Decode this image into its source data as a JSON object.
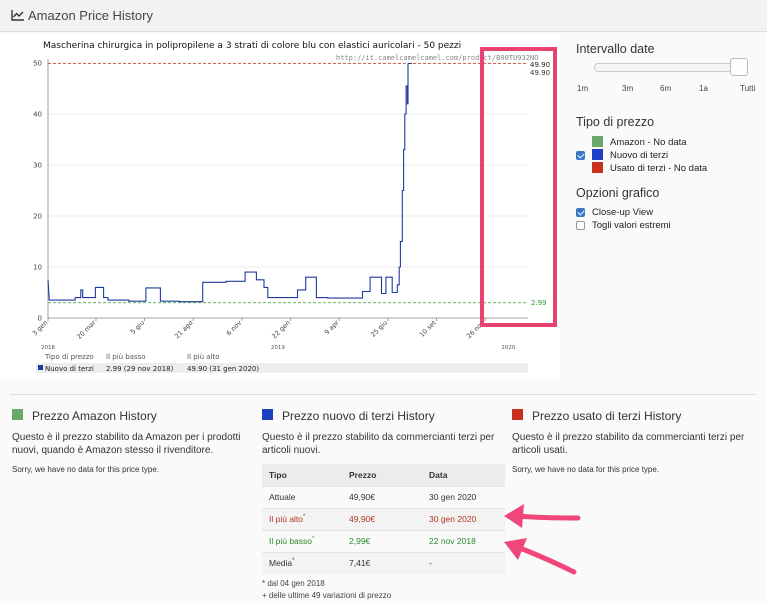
{
  "header": {
    "title": "Amazon Price History"
  },
  "chart": {
    "title": "Mascherina chirurgica in polipropilene a 3 strati di colore blu con elastici auricolari - 50 pezzi",
    "url": "http://it.camelcamelcamel.com/product/B00TU932NO",
    "max_label": "49.90",
    "min_label": "2.99",
    "summary": {
      "col_type": "Tipo di prezzo",
      "col_low": "Il più basso",
      "col_high": "Il più alto",
      "series": "Nuovo di terzi",
      "low": "2.99 (29 nov 2018)",
      "high": "49.90 (31 gen 2020)"
    }
  },
  "chart_data": {
    "type": "line",
    "title": "Mascherina chirurgica in polipropilene a 3 strati di colore blu con elastici auricolari - 50 pezzi",
    "ylim": [
      0,
      50
    ],
    "y_ticks": [
      0,
      10,
      20,
      30,
      40,
      50
    ],
    "x_ticks": [
      "3 gen",
      "20 mar",
      "5 giu",
      "21 ago",
      "6 nov",
      "22 gen",
      "9 apr",
      "25 giu",
      "10 set",
      "26 nov"
    ],
    "year_labels": [
      "2018",
      "2019",
      "2020"
    ],
    "x_range_days": [
      0,
      760
    ],
    "x_tick_days": [
      0,
      76,
      153,
      230,
      307,
      384,
      461,
      538,
      615,
      692
    ],
    "year_label_days": [
      0,
      364,
      729
    ],
    "series": [
      {
        "name": "Nuovo di terzi",
        "color": "#1f3a9e",
        "points": [
          [
            0,
            7.5
          ],
          [
            2,
            3.5
          ],
          [
            43,
            3.5
          ],
          [
            43,
            4
          ],
          [
            52,
            4
          ],
          [
            52,
            5.5
          ],
          [
            55,
            5.5
          ],
          [
            55,
            4
          ],
          [
            75,
            4
          ],
          [
            75,
            6
          ],
          [
            88,
            6
          ],
          [
            88,
            4
          ],
          [
            95,
            4
          ],
          [
            95,
            3.5
          ],
          [
            128,
            3.5
          ],
          [
            128,
            3.3
          ],
          [
            155,
            3.3
          ],
          [
            155,
            5.9
          ],
          [
            178,
            5.9
          ],
          [
            178,
            3.3
          ],
          [
            208,
            3.3
          ],
          [
            208,
            3.2
          ],
          [
            245,
            3.2
          ],
          [
            245,
            7
          ],
          [
            282,
            7
          ],
          [
            282,
            7.2
          ],
          [
            312,
            7.2
          ],
          [
            312,
            9
          ],
          [
            330,
            9
          ],
          [
            330,
            7.5
          ],
          [
            342,
            7.5
          ],
          [
            342,
            6
          ],
          [
            348,
            6
          ],
          [
            348,
            4
          ],
          [
            395,
            4
          ],
          [
            395,
            5.5
          ],
          [
            408,
            5.5
          ],
          [
            408,
            8
          ],
          [
            425,
            8
          ],
          [
            425,
            4
          ],
          [
            443,
            4
          ],
          [
            443,
            3.9
          ],
          [
            498,
            3.9
          ],
          [
            498,
            5.2
          ],
          [
            510,
            5.2
          ],
          [
            510,
            8
          ],
          [
            528,
            8
          ],
          [
            528,
            4.8
          ],
          [
            535,
            4.8
          ],
          [
            535,
            8
          ],
          [
            545,
            8
          ],
          [
            545,
            5
          ],
          [
            553,
            5
          ],
          [
            553,
            6.5
          ],
          [
            556,
            6.5
          ],
          [
            556,
            10
          ],
          [
            558,
            10
          ],
          [
            558,
            15
          ],
          [
            561,
            15
          ],
          [
            561,
            25
          ],
          [
            563,
            25
          ],
          [
            563,
            33
          ],
          [
            565,
            33
          ],
          [
            565,
            40
          ],
          [
            567,
            40
          ],
          [
            567,
            45.5
          ],
          [
            569,
            45.5
          ],
          [
            569,
            42
          ],
          [
            570,
            42
          ],
          [
            570,
            49.9
          ]
        ]
      }
    ],
    "reference_lines": [
      {
        "label": "49.90",
        "value": 49.9,
        "color": "#c0392b"
      },
      {
        "label": "2.99",
        "value": 2.99,
        "color": "#2e9a2e"
      }
    ]
  },
  "controls": {
    "date_range": {
      "title": "Intervallo date",
      "options": [
        "1m",
        "3m",
        "6m",
        "1a",
        "Tutti"
      ],
      "slider_value": 1.0
    },
    "price_type": {
      "title": "Tipo di prezzo",
      "items": [
        {
          "label": "Amazon - No data",
          "color": "#6aa86a",
          "checked": false,
          "has_checkbox": false
        },
        {
          "label": "Nuovo di terzi",
          "color": "#1f3fc2",
          "checked": true,
          "has_checkbox": true
        },
        {
          "label": "Usato di terzi - No data",
          "color": "#c92f1f",
          "checked": false,
          "has_checkbox": false
        }
      ]
    },
    "chart_options": {
      "title": "Opzioni grafico",
      "items": [
        {
          "label": "Close-up View",
          "checked": true
        },
        {
          "label": "Togli valori estremi",
          "checked": false
        }
      ]
    }
  },
  "sections": {
    "amazon": {
      "title": "Prezzo Amazon History",
      "color": "#6aa86a",
      "desc": "Questo è il prezzo stabilito da Amazon per i prodotti nuovi, quando è Amazon stesso il rivenditore.",
      "nodata": "Sorry, we have no data for this price type."
    },
    "new": {
      "title": "Prezzo nuovo di terzi History",
      "color": "#1f3fc2",
      "desc": "Questo è il prezzo stabilito da commercianti terzi per articoli nuovi.",
      "table": {
        "headers": [
          "Tipo",
          "Prezzo",
          "Data"
        ],
        "rows": [
          {
            "type": "Attuale",
            "price": "49,90€",
            "date": "30 gen 2020"
          },
          {
            "type": "Il più alto",
            "price": "49,90€",
            "date": "30 gen 2020"
          },
          {
            "type": "Il più basso",
            "price": "2,99€",
            "date": "22 nov 2018"
          },
          {
            "type": "Media",
            "price": "7,41€",
            "date": "-"
          }
        ]
      },
      "footnote1": "* dal 04 gen 2018",
      "footnote2": "+ delle ultime 49 variazioni di prezzo"
    },
    "used": {
      "title": "Prezzo usato di terzi History",
      "color": "#c92f1f",
      "desc": "Questo è il prezzo stabilito da commercianti terzi per articoli usati.",
      "nodata": "Sorry, we have no data for this price type."
    }
  },
  "annotations": {
    "highlight_color": "#e8426e",
    "arrow_color": "#f0467a"
  }
}
